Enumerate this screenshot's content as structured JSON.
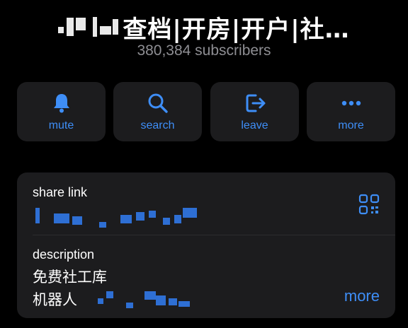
{
  "header": {
    "title": "查档|开房|开户|社…",
    "subscribers": "380,384 subscribers"
  },
  "actions": [
    {
      "label": "mute",
      "icon": "bell-icon"
    },
    {
      "label": "search",
      "icon": "search-icon"
    },
    {
      "label": "leave",
      "icon": "leave-icon"
    },
    {
      "label": "more",
      "icon": "more-dots-icon"
    }
  ],
  "info": {
    "share_link_label": "share link",
    "description_label": "description",
    "description_line1": "免费社工库",
    "description_line2": "机器人",
    "more_label": "more"
  },
  "colors": {
    "background": "#000000",
    "card": "#1c1c1e",
    "accent": "#3e8ef7",
    "secondary_text": "#8e8e93"
  }
}
